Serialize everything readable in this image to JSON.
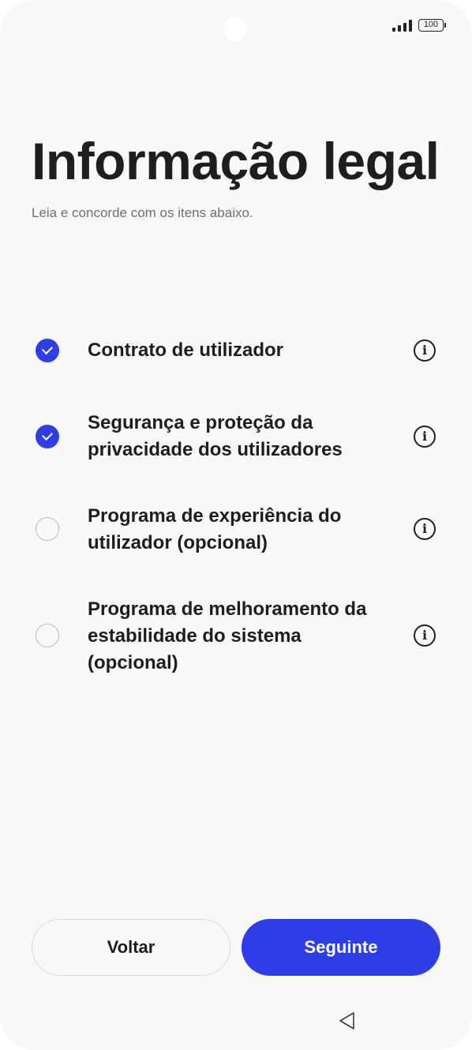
{
  "status_bar": {
    "battery_level": "100",
    "icons": [
      "camera-cutout",
      "signal-icon",
      "battery-icon"
    ]
  },
  "header": {
    "title": "Informação legal",
    "subtitle": "Leia e concorde com os itens abaixo."
  },
  "items": [
    {
      "label": "Contrato de utilizador",
      "checked": true
    },
    {
      "label": "Segurança e proteção da privacidade dos utilizadores",
      "checked": true
    },
    {
      "label": "Programa de experiência do utilizador (opcional)",
      "checked": false
    },
    {
      "label": "Programa de melhoramento da estabilidade do sistema (opcional)",
      "checked": false
    }
  ],
  "info_icon_glyph": "i",
  "footer": {
    "back_label": "Voltar",
    "next_label": "Seguinte"
  },
  "colors": {
    "accent": "#2d3ee6",
    "background": "#f8f8f8",
    "text": "#1e1e1e"
  }
}
